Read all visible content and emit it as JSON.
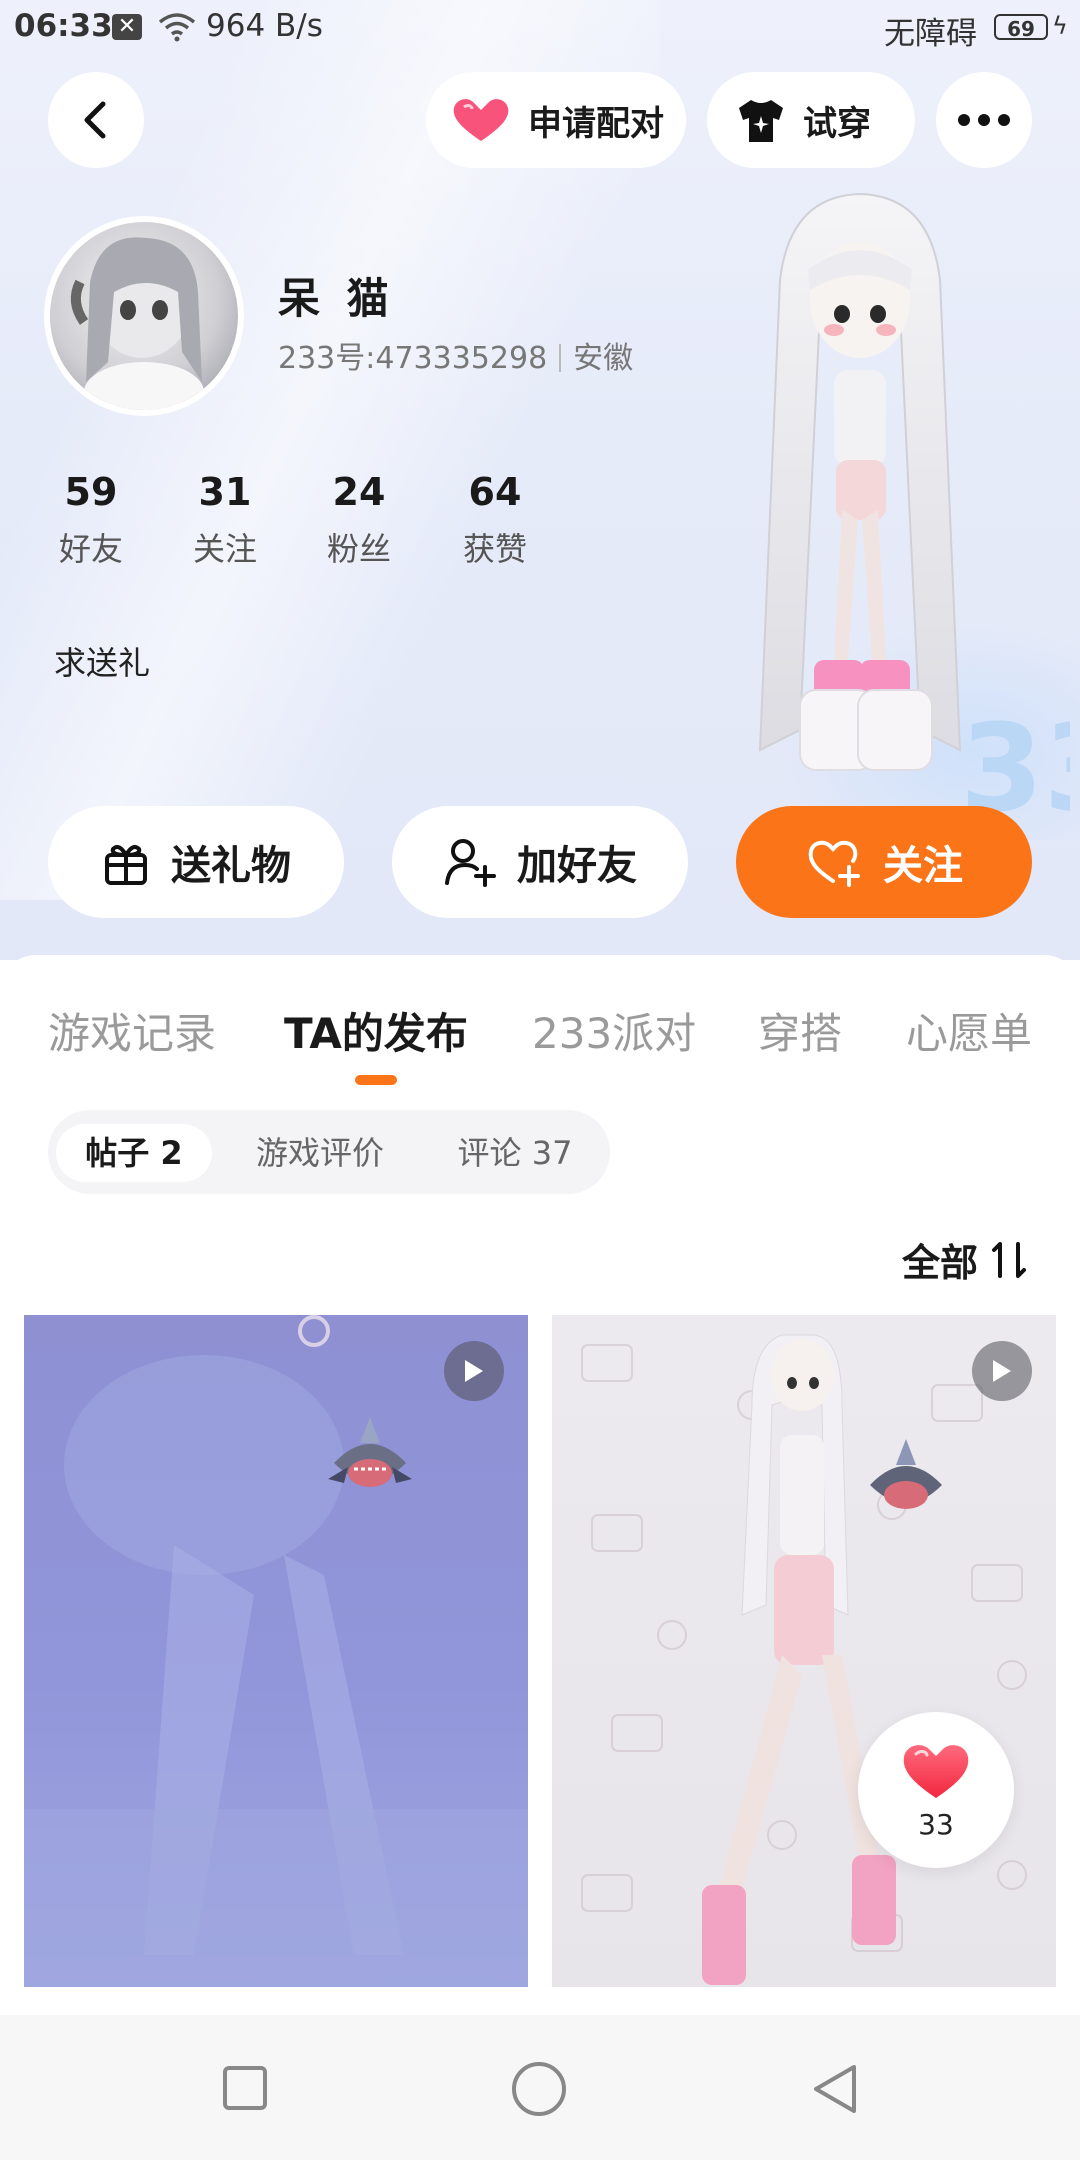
{
  "status_bar": {
    "time": "06:33",
    "net_speed": "964 B/s",
    "accessibility": "无障碍",
    "battery": "69"
  },
  "top_bar": {
    "pair_label": "申请配对",
    "tryon_label": "试穿"
  },
  "profile": {
    "name": "呆 猫",
    "uid": "233号:473335298",
    "region": "安徽",
    "bio": "求送礼",
    "stats": [
      {
        "value": "59",
        "label": "好友"
      },
      {
        "value": "31",
        "label": "关注"
      },
      {
        "value": "24",
        "label": "粉丝"
      },
      {
        "value": "64",
        "label": "获赞"
      }
    ]
  },
  "actions": {
    "gift": "送礼物",
    "add_friend": "加好友",
    "follow": "关注"
  },
  "tabs": [
    "游戏记录",
    "TA的发布",
    "233派对",
    "穿搭",
    "心愿单"
  ],
  "active_tab": "TA的发布",
  "subtabs": [
    "帖子 2",
    "游戏评价",
    "评论 37"
  ],
  "sort_label": "全部",
  "posts": [
    {
      "likes": ""
    },
    {
      "likes": "33"
    }
  ],
  "colors": {
    "accent": "#fb7418",
    "heart": "#fb4d6a"
  }
}
